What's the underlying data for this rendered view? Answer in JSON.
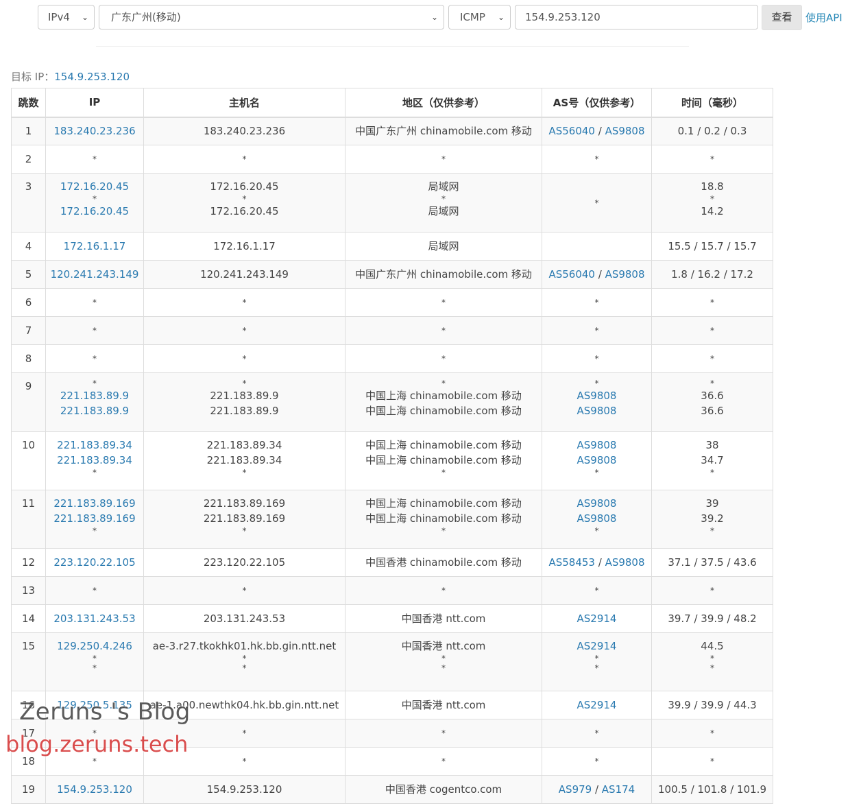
{
  "form": {
    "ip_version": "IPv4",
    "node": "广东广州(移动)",
    "protocol": "ICMP",
    "target_value": "154.9.253.120",
    "search_label": "查看",
    "api_label": "使用API"
  },
  "target": {
    "label": "目标 IP：",
    "ip": "154.9.253.120"
  },
  "table": {
    "headers": {
      "hop": "跳数",
      "ip": "IP",
      "host": "主机名",
      "region": "地区（仅供参考）",
      "asn": "AS号（仅供参考）",
      "time": "时间（毫秒）"
    },
    "rows": [
      {
        "hop": "1",
        "ip": [
          "183.240.23.236"
        ],
        "host": [
          "183.240.23.236"
        ],
        "region": [
          "中国广东广州 chinamobile.com 移动"
        ],
        "asn": [
          [
            "AS56040",
            "AS9808"
          ]
        ],
        "time": [
          "0.1 / 0.2 / 0.3"
        ]
      },
      {
        "hop": "2",
        "ip": [
          "*"
        ],
        "host": [
          "*"
        ],
        "region": [
          "*"
        ],
        "asn": [
          [
            "*"
          ]
        ],
        "time": [
          "*"
        ]
      },
      {
        "hop": "3",
        "ip": [
          "172.16.20.45",
          "*",
          "172.16.20.45"
        ],
        "host": [
          "172.16.20.45",
          "*",
          "172.16.20.45"
        ],
        "region": [
          "局域网",
          "*",
          "局域网"
        ],
        "asn": [
          [
            ""
          ],
          [
            "*"
          ],
          [
            ""
          ]
        ],
        "time": [
          "18.8",
          "*",
          "14.2"
        ]
      },
      {
        "hop": "4",
        "ip": [
          "172.16.1.17"
        ],
        "host": [
          "172.16.1.17"
        ],
        "region": [
          "局域网"
        ],
        "asn": [
          [
            ""
          ]
        ],
        "time": [
          "15.5 / 15.7 / 15.7"
        ]
      },
      {
        "hop": "5",
        "ip": [
          "120.241.243.149"
        ],
        "host": [
          "120.241.243.149"
        ],
        "region": [
          "中国广东广州 chinamobile.com 移动"
        ],
        "asn": [
          [
            "AS56040",
            "AS9808"
          ]
        ],
        "time": [
          "1.8 / 16.2 / 17.2"
        ]
      },
      {
        "hop": "6",
        "ip": [
          "*"
        ],
        "host": [
          "*"
        ],
        "region": [
          "*"
        ],
        "asn": [
          [
            "*"
          ]
        ],
        "time": [
          "*"
        ]
      },
      {
        "hop": "7",
        "ip": [
          "*"
        ],
        "host": [
          "*"
        ],
        "region": [
          "*"
        ],
        "asn": [
          [
            "*"
          ]
        ],
        "time": [
          "*"
        ]
      },
      {
        "hop": "8",
        "ip": [
          "*"
        ],
        "host": [
          "*"
        ],
        "region": [
          "*"
        ],
        "asn": [
          [
            "*"
          ]
        ],
        "time": [
          "*"
        ]
      },
      {
        "hop": "9",
        "ip": [
          "*",
          "221.183.89.9",
          "221.183.89.9"
        ],
        "host": [
          "*",
          "221.183.89.9",
          "221.183.89.9"
        ],
        "region": [
          "*",
          "中国上海 chinamobile.com 移动",
          "中国上海 chinamobile.com 移动"
        ],
        "asn": [
          [
            "*"
          ],
          [
            "AS9808"
          ],
          [
            "AS9808"
          ]
        ],
        "time": [
          "*",
          "36.6",
          "36.6"
        ]
      },
      {
        "hop": "10",
        "ip": [
          "221.183.89.34",
          "221.183.89.34",
          "*"
        ],
        "host": [
          "221.183.89.34",
          "221.183.89.34",
          "*"
        ],
        "region": [
          "中国上海 chinamobile.com 移动",
          "中国上海 chinamobile.com 移动",
          "*"
        ],
        "asn": [
          [
            "AS9808"
          ],
          [
            "AS9808"
          ],
          [
            "*"
          ]
        ],
        "time": [
          "38",
          "34.7",
          "*"
        ]
      },
      {
        "hop": "11",
        "ip": [
          "221.183.89.169",
          "221.183.89.169",
          "*"
        ],
        "host": [
          "221.183.89.169",
          "221.183.89.169",
          "*"
        ],
        "region": [
          "中国上海 chinamobile.com 移动",
          "中国上海 chinamobile.com 移动",
          "*"
        ],
        "asn": [
          [
            "AS9808"
          ],
          [
            "AS9808"
          ],
          [
            "*"
          ]
        ],
        "time": [
          "39",
          "39.2",
          "*"
        ]
      },
      {
        "hop": "12",
        "ip": [
          "223.120.22.105"
        ],
        "host": [
          "223.120.22.105"
        ],
        "region": [
          "中国香港 chinamobile.com 移动"
        ],
        "asn": [
          [
            "AS58453",
            "AS9808"
          ]
        ],
        "time": [
          "37.1 / 37.5 / 43.6"
        ]
      },
      {
        "hop": "13",
        "ip": [
          "*"
        ],
        "host": [
          "*"
        ],
        "region": [
          "*"
        ],
        "asn": [
          [
            "*"
          ]
        ],
        "time": [
          "*"
        ]
      },
      {
        "hop": "14",
        "ip": [
          "203.131.243.53"
        ],
        "host": [
          "203.131.243.53"
        ],
        "region": [
          "中国香港 ntt.com"
        ],
        "asn": [
          [
            "AS2914"
          ]
        ],
        "time": [
          "39.7 / 39.9 / 48.2"
        ]
      },
      {
        "hop": "15",
        "ip": [
          "129.250.4.246",
          "*",
          "*"
        ],
        "host": [
          "ae-3.r27.tkokhk01.hk.bb.gin.ntt.net",
          "*",
          "*"
        ],
        "region": [
          "中国香港 ntt.com",
          "*",
          "*"
        ],
        "asn": [
          [
            "AS2914"
          ],
          [
            "*"
          ],
          [
            "*"
          ]
        ],
        "time": [
          "44.5",
          "*",
          "*"
        ]
      },
      {
        "hop": "16",
        "ip": [
          "129.250.5.135"
        ],
        "host": [
          "ae-1.a00.newthk04.hk.bb.gin.ntt.net"
        ],
        "region": [
          "中国香港 ntt.com"
        ],
        "asn": [
          [
            "AS2914"
          ]
        ],
        "time": [
          "39.9 / 39.9 / 44.3"
        ]
      },
      {
        "hop": "17",
        "ip": [
          "*"
        ],
        "host": [
          "*"
        ],
        "region": [
          "*"
        ],
        "asn": [
          [
            "*"
          ]
        ],
        "time": [
          "*"
        ]
      },
      {
        "hop": "18",
        "ip": [
          "*"
        ],
        "host": [
          "*"
        ],
        "region": [
          "*"
        ],
        "asn": [
          [
            "*"
          ]
        ],
        "time": [
          "*"
        ]
      },
      {
        "hop": "19",
        "ip": [
          "154.9.253.120"
        ],
        "host": [
          "154.9.253.120"
        ],
        "region": [
          "中国香港 cogentco.com"
        ],
        "asn": [
          [
            "AS979",
            "AS174"
          ]
        ],
        "time": [
          "100.5 / 101.8 / 101.9"
        ]
      }
    ]
  },
  "watermark": {
    "line1": "Zeruns 's Blog",
    "line2": "blog.zeruns.tech"
  }
}
